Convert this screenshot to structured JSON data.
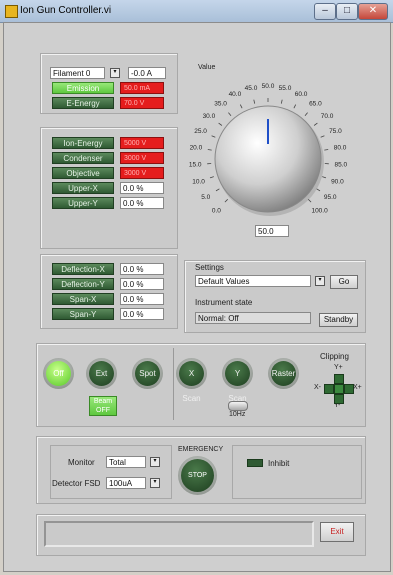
{
  "window": {
    "title": "Ion Gun Controller.vi",
    "minimize": "–",
    "maximize": "□",
    "close": "✕"
  },
  "filament": {
    "selector_value": "Filament 0",
    "current_value": "-0.0 A",
    "emission_label": "Emission",
    "emission_value": "50.0 mA",
    "e_energy_label": "E-Energy",
    "e_energy_value": "70.0 V"
  },
  "voltages": {
    "ion_energy_label": "Ion-Energy",
    "ion_energy_value": "5000 V",
    "condenser_label": "Condenser",
    "condenser_value": "3000 V",
    "objective_label": "Objective",
    "objective_value": "3000 V",
    "upper_x_label": "Upper-X",
    "upper_x_value": "0.0 %",
    "upper_y_label": "Upper-Y",
    "upper_y_value": "0.0 %"
  },
  "knob": {
    "label": "Value",
    "ticks": [
      "0.0",
      "5.0",
      "10.0",
      "15.0",
      "20.0",
      "25.0",
      "30.0",
      "35.0",
      "40.0",
      "45.0",
      "50.0",
      "55.0",
      "60.0",
      "65.0",
      "70.0",
      "75.0",
      "80.0",
      "85.0",
      "90.0",
      "95.0",
      "100.0"
    ],
    "value": 50.0,
    "value_text": "50.0",
    "pointer_color": "#1f4fc8"
  },
  "deflection": {
    "deflection_x_label": "Deflection-X",
    "deflection_x_value": "0.0 %",
    "deflection_y_label": "Deflection-Y",
    "deflection_y_value": "0.0 %",
    "span_x_label": "Span-X",
    "span_x_value": "0.0 %",
    "span_y_label": "Span-Y",
    "span_y_value": "0.0 %"
  },
  "settings": {
    "label": "Settings",
    "selected": "Default Values",
    "go_label": "Go",
    "instrument_state_label": "Instrument state",
    "instrument_state_value": "Normal: Off",
    "standby_label": "Standby"
  },
  "beam": {
    "off_label": "Off",
    "ext_label": "Ext",
    "spot_label": "Spot",
    "beam_off_label": "Beam OFF",
    "x_scan_label": "X Scan",
    "y_scan_label": "Y Scan",
    "raster_label": "Raster",
    "freq_label": "10Hz",
    "clipping_label": "Clipping",
    "clip_y_plus": "Y+",
    "clip_y_minus": "Y-",
    "clip_x_plus": "X+",
    "clip_x_minus": "X-"
  },
  "monitor": {
    "monitor_label": "Monitor",
    "monitor_value": "Total",
    "detector_label": "Detector FSD",
    "detector_value": "100uA",
    "emergency_label": "EMERGENCY",
    "stop_label": "STOP",
    "inhibit_label": "Inhibit"
  },
  "footer": {
    "exit_label": "Exit"
  },
  "colors": {
    "accent_green": "#2f5a33",
    "indicator_red": "#e51d1d",
    "lime_on": "#57c928"
  }
}
